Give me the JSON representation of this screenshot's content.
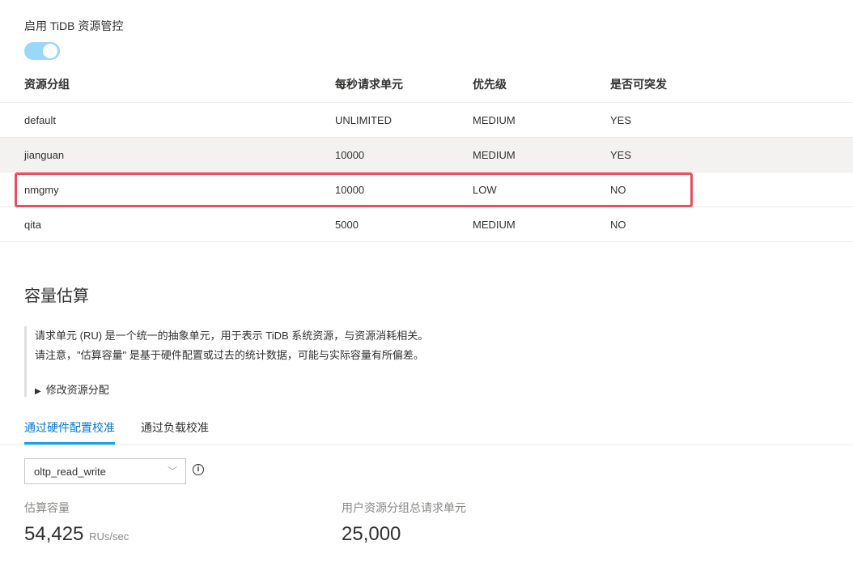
{
  "settings": {
    "enable_label": "启用 TiDB 资源管控",
    "enabled": true
  },
  "table": {
    "headers": [
      "资源分组",
      "每秒请求单元",
      "优先级",
      "是否可突发"
    ],
    "rows": [
      [
        "default",
        "UNLIMITED",
        "MEDIUM",
        "YES"
      ],
      [
        "jianguan",
        "10000",
        "MEDIUM",
        "YES"
      ],
      [
        "nmgmy",
        "10000",
        "LOW",
        "NO"
      ],
      [
        "qita",
        "5000",
        "MEDIUM",
        "NO"
      ]
    ]
  },
  "capacity": {
    "heading": "容量估算",
    "note_line1": "请求单元 (RU) 是一个统一的抽象单元，用于表示 TiDB 系统资源，与资源消耗相关。",
    "note_line2": "请注意，\"估算容量\" 是基于硬件配置或过去的统计数据，可能与实际容量有所偏差。",
    "expander": "修改资源分配",
    "tabs": [
      "通过硬件配置校准",
      "通过负载校准"
    ],
    "workload": "oltp_read_write",
    "estimated_label": "估算容量",
    "estimated_value": "54,425",
    "estimated_unit": "RUs/sec",
    "total_label": "用户资源分组总请求单元",
    "total_value": "25,000"
  },
  "colors": {
    "accent": "#0078d4",
    "highlight": "#e8505b",
    "toggle": "#9ad8f7"
  }
}
